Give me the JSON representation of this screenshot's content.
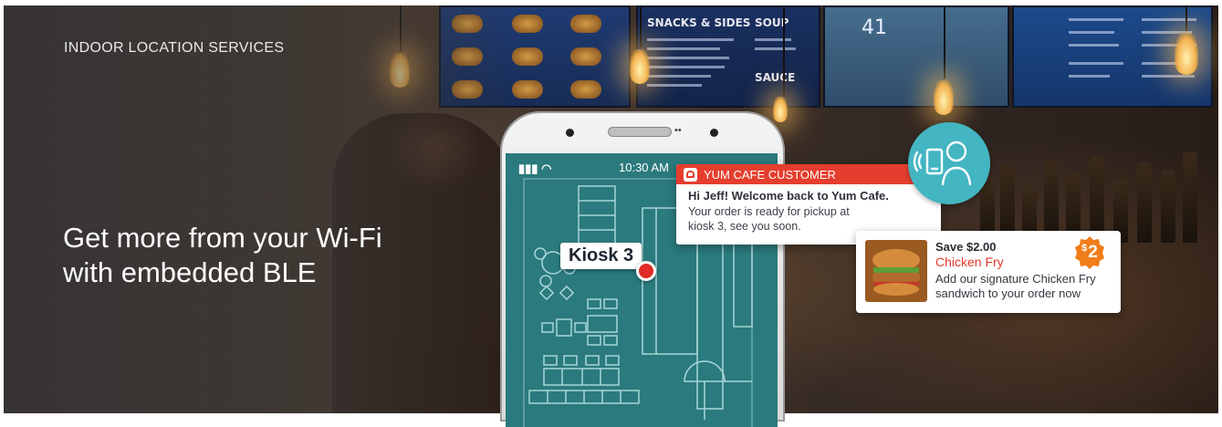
{
  "hero": {
    "eyebrow": "INDOOR LOCATION SERVICES",
    "headline": "Get more from your Wi-Fi with embedded BLE"
  },
  "menu_boards": {
    "snacks_title": "SNACKS & SIDES",
    "soup_title": "SOUP",
    "sauce_title": "SAUCE",
    "board_number": "41"
  },
  "phone": {
    "status_signal": "▮▮▮ ◠",
    "status_time": "10:30 AM",
    "speaker_dots": "••"
  },
  "map": {
    "kiosk_label": "Kiosk 3"
  },
  "notification": {
    "header": "YUM CAFE CUSTOMER",
    "header_icon": "burger-icon",
    "title": "Hi Jeff! Welcome back to Yum Cafe.",
    "body": "Your order is ready for pickup at kiosk 3, see you soon."
  },
  "offer": {
    "save": "Save $2.00",
    "name": "Chicken Fry",
    "description": "Add our signature Chicken Fry sandwich to your order now",
    "badge_symbol": "$",
    "badge_value": "2",
    "image": "chicken-fry-sandwich-image"
  },
  "person_badge": {
    "icon": "person-with-phone-icon"
  },
  "colors": {
    "accent_red": "#e53e2e",
    "teal": "#44b5c2",
    "map_teal": "#2b7a7d",
    "badge_orange": "#f07d1a"
  }
}
